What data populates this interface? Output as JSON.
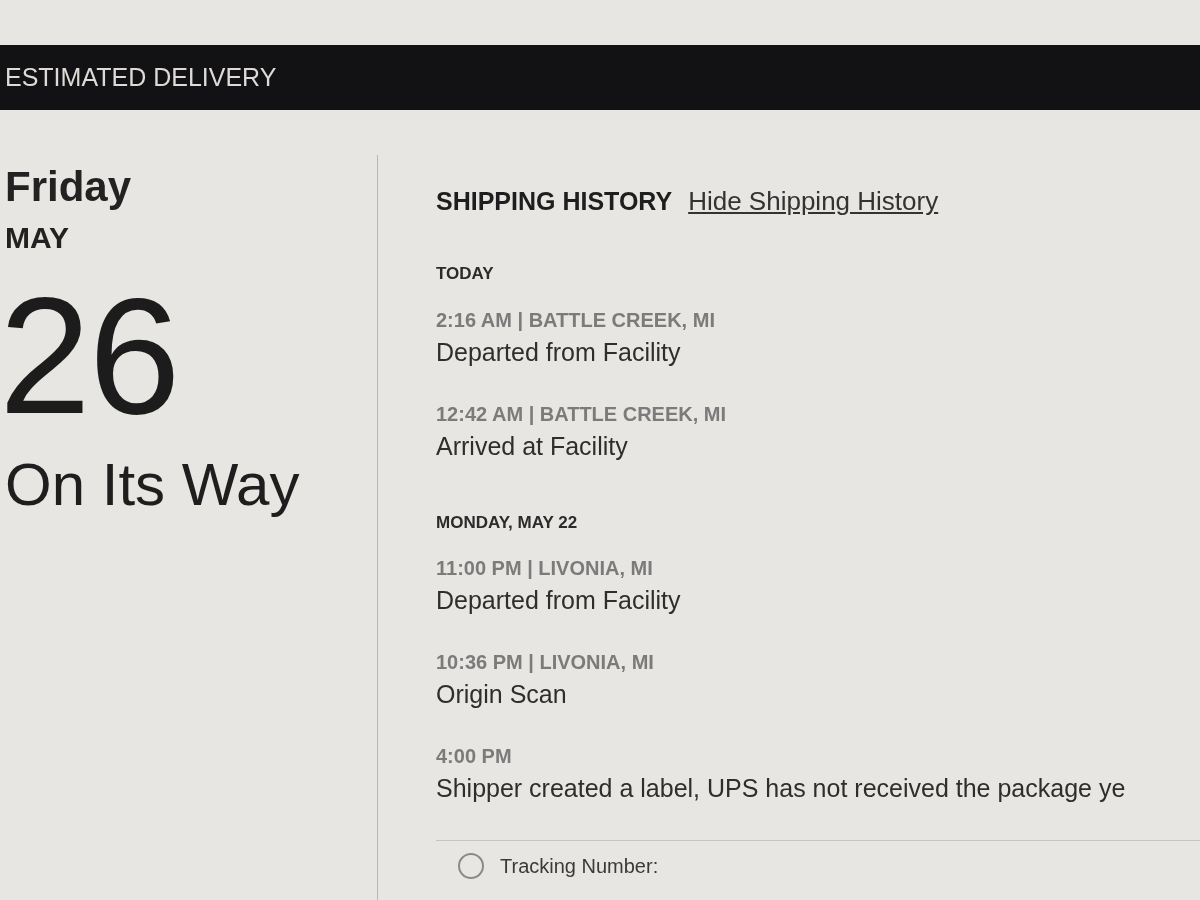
{
  "header": {
    "title": "ESTIMATED DELIVERY"
  },
  "estimate": {
    "day_name": "Friday",
    "month": "MAY",
    "day": "26",
    "status": "On Its Way"
  },
  "shipping_history": {
    "title": "SHIPPING HISTORY",
    "toggle_link": "Hide Shipping History",
    "groups": [
      {
        "date": "TODAY",
        "events": [
          {
            "meta": "2:16 AM | BATTLE CREEK, MI",
            "description": "Departed from Facility"
          },
          {
            "meta": "12:42 AM | BATTLE CREEK, MI",
            "description": "Arrived at Facility"
          }
        ]
      },
      {
        "date": "MONDAY, MAY 22",
        "events": [
          {
            "meta": "11:00 PM | LIVONIA, MI",
            "description": "Departed from Facility"
          },
          {
            "meta": "10:36 PM | LIVONIA, MI",
            "description": "Origin Scan"
          },
          {
            "meta": "4:00 PM",
            "description": "Shipper created a label, UPS has not received the package ye"
          }
        ]
      }
    ]
  },
  "tracking": {
    "label": "Tracking Number:"
  }
}
